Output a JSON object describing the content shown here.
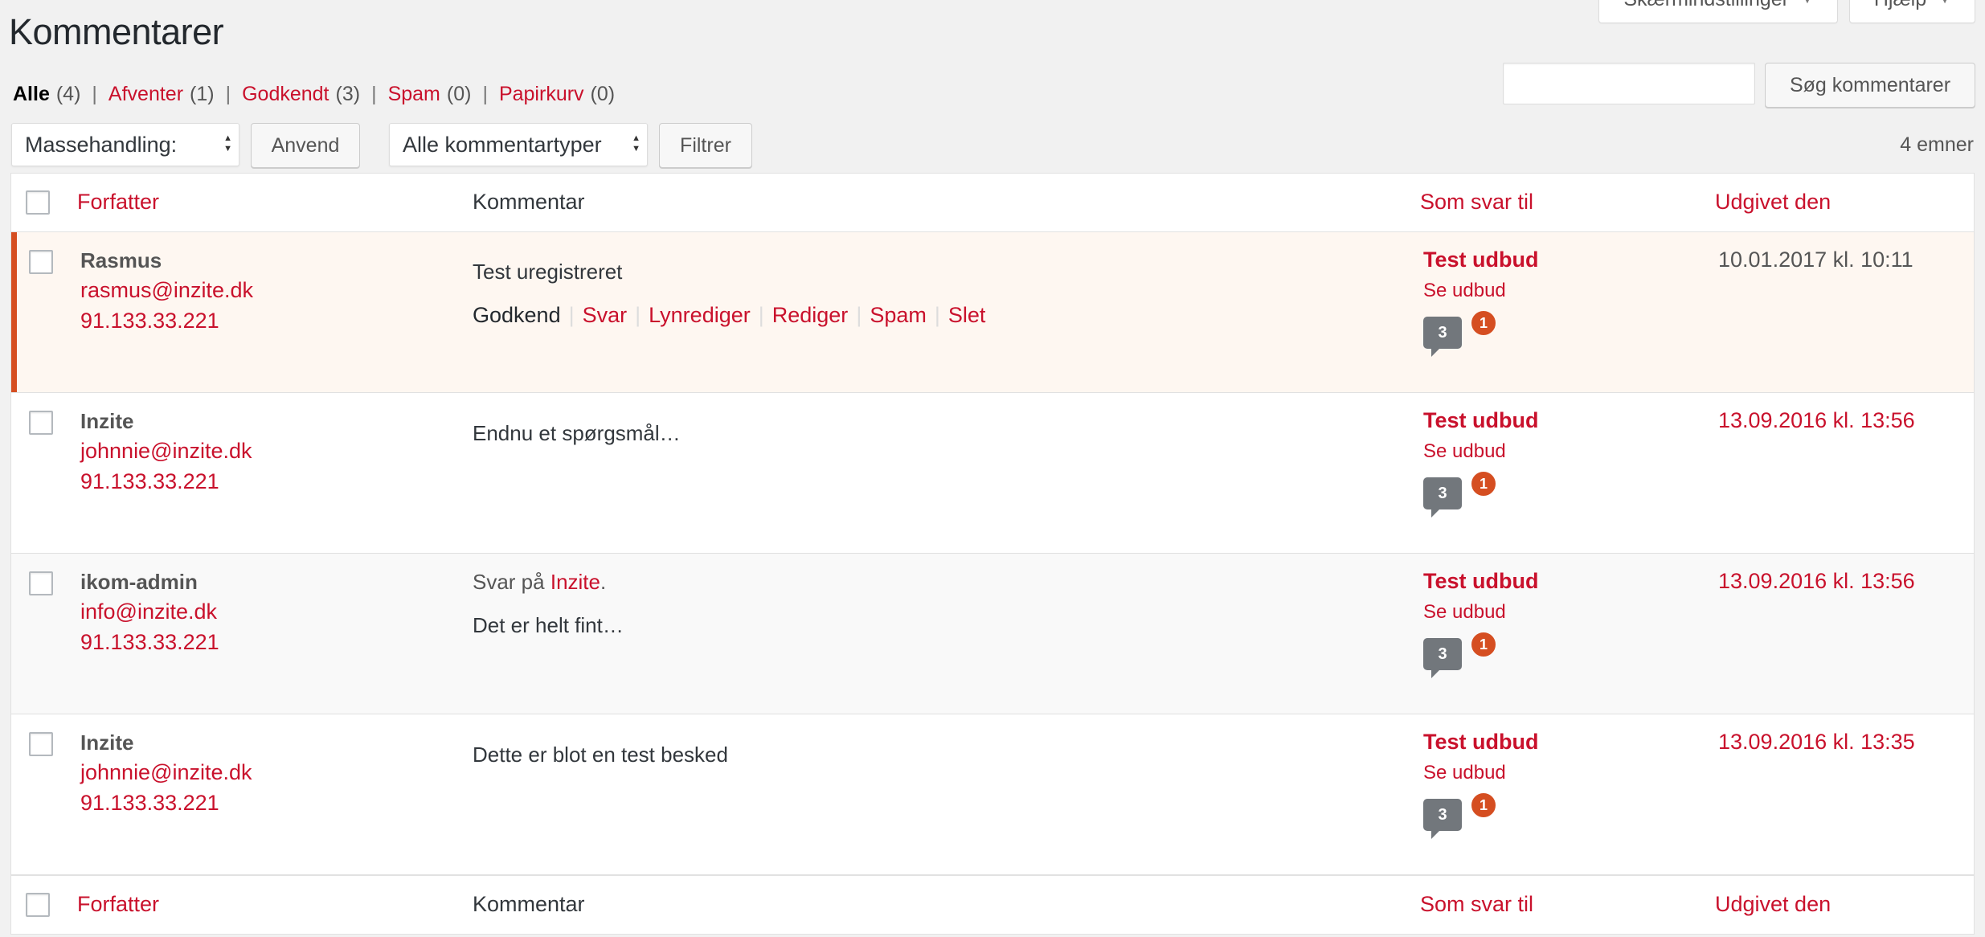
{
  "screen_tabs": {
    "screen_options": "Skærmindstillinger",
    "help": "Hjælp"
  },
  "page_title": "Kommentarer",
  "filters": [
    {
      "label": "Alle",
      "count": "(4)",
      "current": true
    },
    {
      "label": "Afventer",
      "count": "(1)",
      "current": false
    },
    {
      "label": "Godkendt",
      "count": "(3)",
      "current": false
    },
    {
      "label": "Spam",
      "count": "(0)",
      "current": false
    },
    {
      "label": "Papirkurv",
      "count": "(0)",
      "current": false
    }
  ],
  "filter_separator": "|",
  "search": {
    "value": "",
    "button": "Søg kommentarer"
  },
  "bulk": {
    "selected": "Massehandling:",
    "apply": "Anvend"
  },
  "type_filter": {
    "selected": "Alle kommentartyper",
    "button": "Filtrer"
  },
  "item_count": "4 emner",
  "columns": {
    "author": "Forfatter",
    "comment": "Kommentar",
    "response": "Som svar til",
    "date": "Udgivet den"
  },
  "rows": [
    {
      "author": "Rasmus",
      "email": "rasmus@inzite.dk",
      "ip": "91.133.33.221",
      "comment": "Test uregistreret",
      "response_title": "Test udbud",
      "response_view": "Se udbud",
      "comment_count": "3",
      "pending_count": "1",
      "date": "10.01.2017 kl. 10:11",
      "actions": {
        "approve": "Godkend",
        "reply": "Svar",
        "quick_edit": "Lynrediger",
        "edit": "Rediger",
        "spam": "Spam",
        "delete": "Slet"
      }
    },
    {
      "author": "Inzite",
      "email": "johnnie@inzite.dk",
      "ip": "91.133.33.221",
      "comment": "Endnu et spørgsmål…",
      "response_title": "Test udbud",
      "response_view": "Se udbud",
      "comment_count": "3",
      "pending_count": "1",
      "date": "13.09.2016 kl. 13:56"
    },
    {
      "author": "ikom-admin",
      "email": "info@inzite.dk",
      "ip": "91.133.33.221",
      "reply_prefix": "Svar på",
      "reply_to": "Inzite",
      "reply_suffix": ".",
      "comment": "Det er helt fint…",
      "response_title": "Test udbud",
      "response_view": "Se udbud",
      "comment_count": "3",
      "pending_count": "1",
      "date": "13.09.2016 kl. 13:56"
    },
    {
      "author": "Inzite",
      "email": "johnnie@inzite.dk",
      "ip": "91.133.33.221",
      "comment": "Dette er blot en test besked",
      "response_title": "Test udbud",
      "response_view": "Se udbud",
      "comment_count": "3",
      "pending_count": "1",
      "date": "13.09.2016 kl. 13:35"
    }
  ]
}
